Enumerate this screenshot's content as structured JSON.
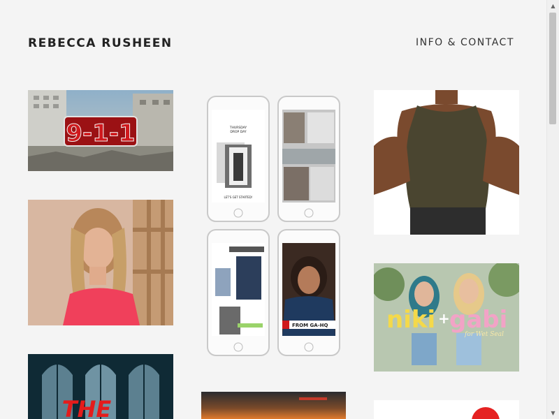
{
  "header": {
    "site_title": "REBECCA RUSHEEN",
    "nav_link": "INFO & CONTACT"
  },
  "tiles": {
    "nine_one_one": {
      "logo_text": "9-1-1"
    },
    "phones": {
      "phone1_line1": "THURSDAY",
      "phone1_line2": "DROP DAY",
      "phone1_cta": "LET'S GET STARTED!",
      "phone4_caption": "FROM GA-HQ"
    },
    "niki_gabi": {
      "name_left": "niki",
      "plus": "+",
      "name_right": "gabi",
      "sub": "for Wet Seal"
    },
    "the_poster": {
      "title_text": "THE"
    }
  },
  "colors": {
    "background": "#f4f4f4",
    "title_text": "#222222",
    "logo_red": "#d0191d"
  }
}
